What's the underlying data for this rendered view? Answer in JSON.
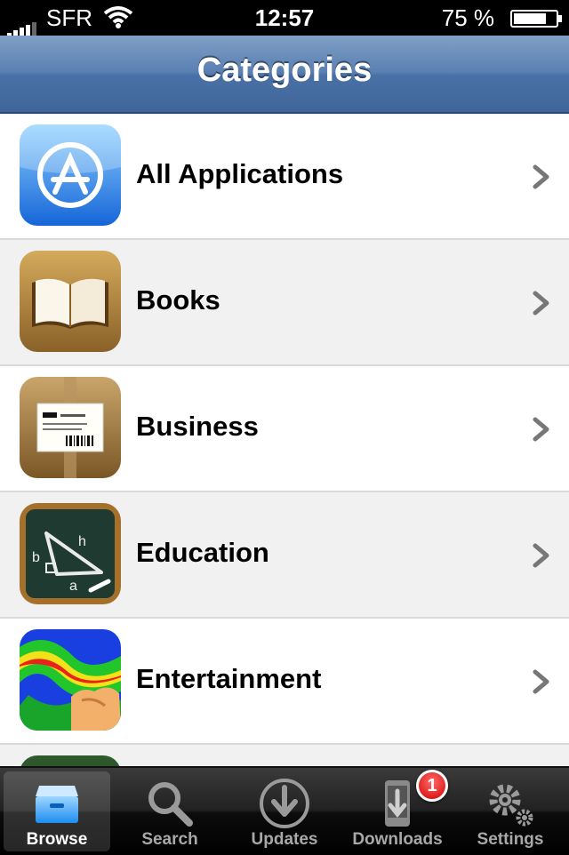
{
  "status_bar": {
    "carrier": "SFR",
    "time": "12:57",
    "battery": "75 %",
    "battery_level": 0.75
  },
  "nav": {
    "title": "Categories"
  },
  "categories": [
    {
      "label": "All Applications",
      "icon": "app-store-icon"
    },
    {
      "label": "Books",
      "icon": "books-icon"
    },
    {
      "label": "Business",
      "icon": "business-icon"
    },
    {
      "label": "Education",
      "icon": "education-icon"
    },
    {
      "label": "Entertainment",
      "icon": "entertainment-icon"
    }
  ],
  "tabs": [
    {
      "label": "Browse",
      "icon": "browse-icon",
      "active": true
    },
    {
      "label": "Search",
      "icon": "search-icon",
      "active": false
    },
    {
      "label": "Updates",
      "icon": "updates-icon",
      "active": false
    },
    {
      "label": "Downloads",
      "icon": "downloads-icon",
      "active": false
    },
    {
      "label": "Settings",
      "icon": "settings-icon",
      "active": false
    }
  ],
  "downloads_badge": "1",
  "colors": {
    "nav": "#4a71a7",
    "badge": "#d40000"
  }
}
